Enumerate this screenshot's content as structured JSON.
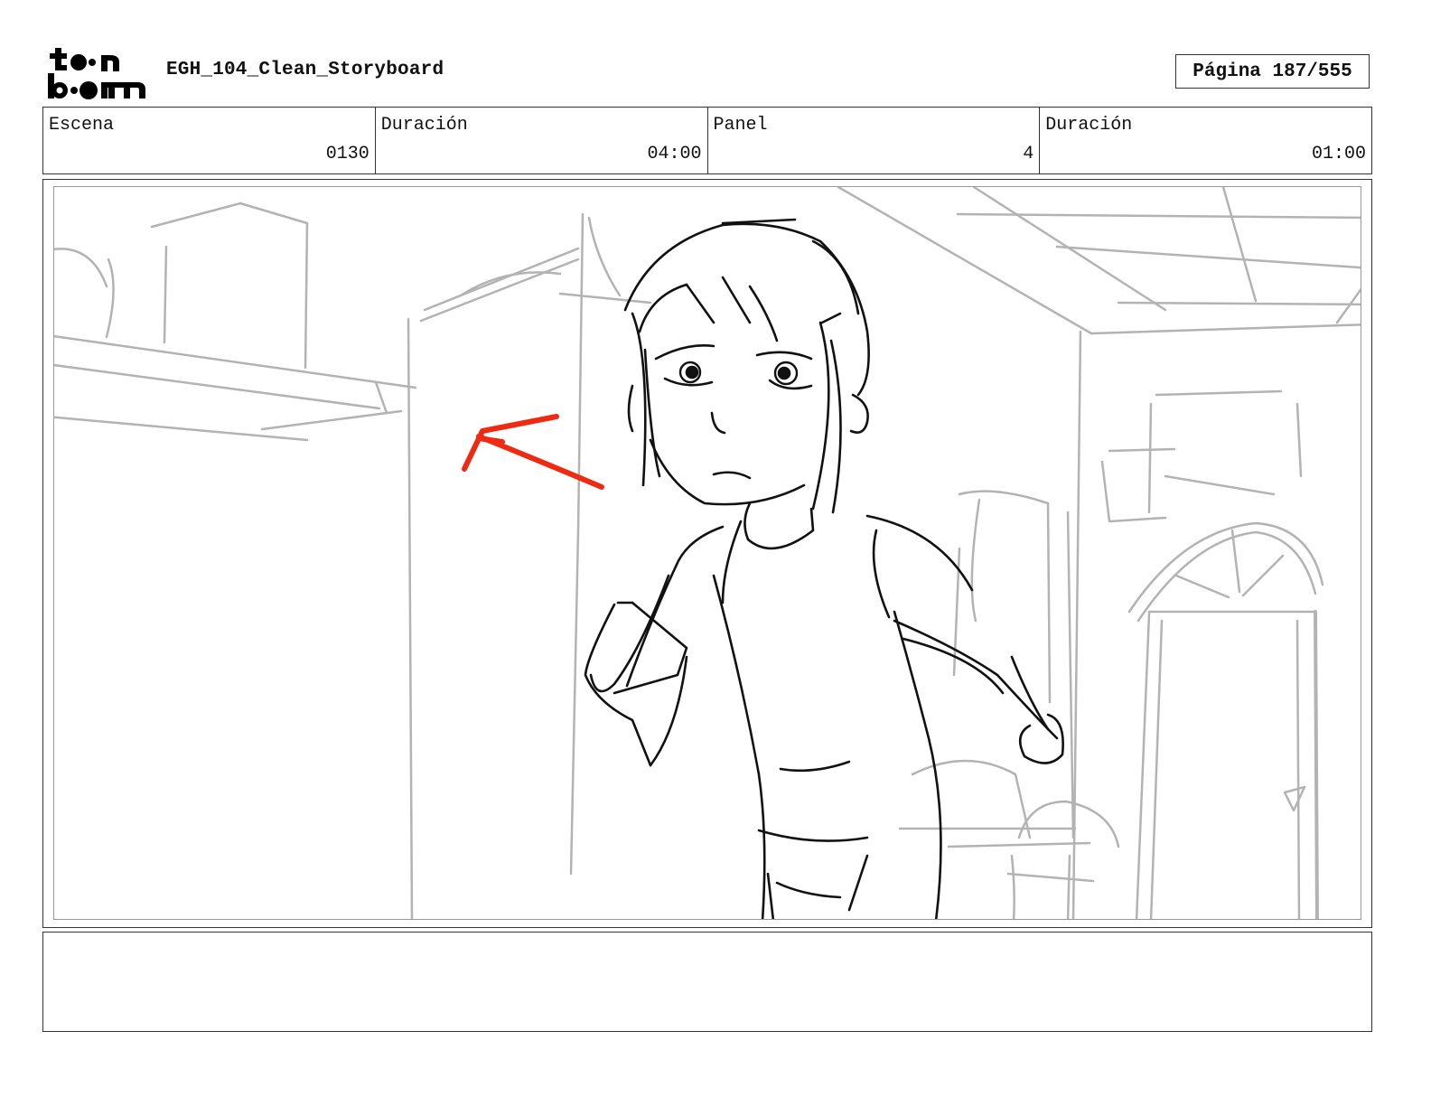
{
  "header": {
    "logo_text": "toon boom",
    "doc_title": "EGH_104_Clean_Storyboard",
    "page_label": "Página 187/555"
  },
  "info": [
    {
      "label": "Escena",
      "value": "0130"
    },
    {
      "label": "Duración",
      "value": "04:00"
    },
    {
      "label": "Panel",
      "value": "4"
    },
    {
      "label": "Duración",
      "value": "01:00"
    }
  ],
  "panel": {
    "arrow_color": "#ee2a12",
    "line_color": "#111111",
    "bg_line_color": "#b0b0b0"
  },
  "notes": {
    "text": ""
  }
}
